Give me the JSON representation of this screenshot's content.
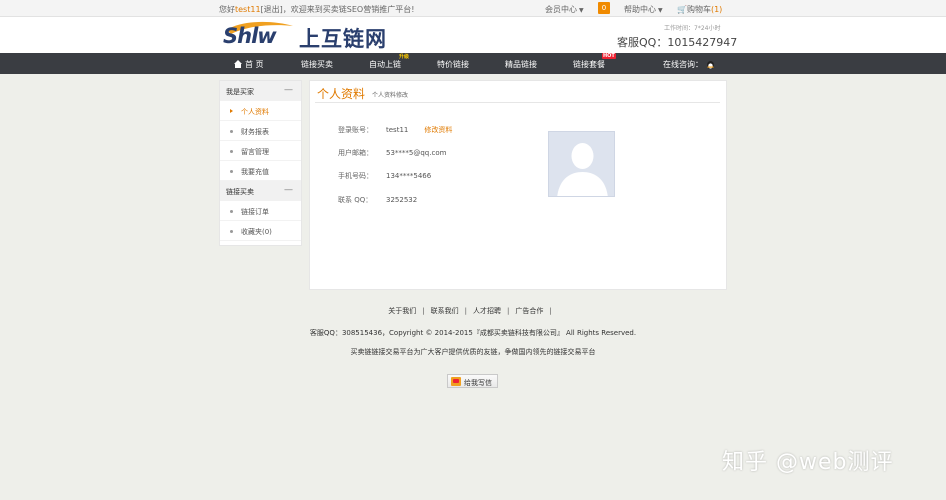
{
  "topbar": {
    "greet_prefix": "您好",
    "username": "test11",
    "greet_suffix": "[退出]，欢迎来到买卖链SEO营销推广平台!",
    "member_center": "会员中心",
    "member_badge": "0",
    "help_center": "帮助中心",
    "cart_label": "购物车",
    "cart_count": "(1)"
  },
  "header": {
    "logo_en": "Shlw",
    "logo_cn": "上互链网",
    "work_time": "工作时间：7*24小时",
    "service_qq": "客服QQ：1015427947"
  },
  "nav": {
    "items": [
      {
        "label": "首 页"
      },
      {
        "label": "链接买卖"
      },
      {
        "label": "自动上链",
        "tag": "升级"
      },
      {
        "label": "特价链接"
      },
      {
        "label": "精品链接"
      },
      {
        "label": "链接套餐",
        "tag": "HOT"
      }
    ],
    "consult": "在线咨询："
  },
  "sidebar": {
    "group1": "我是买家",
    "group1_items": [
      "个人资料",
      "财务报表",
      "留言管理",
      "我要充值"
    ],
    "group2": "链接买卖",
    "group2_items": [
      "链接订单",
      "收藏夹(0)"
    ],
    "collapse_symbol": "—"
  },
  "main": {
    "title": "个人资料",
    "subtitle": "个人资料修改",
    "fields": [
      {
        "label": "登录账号：",
        "value": "test11",
        "action": "修改资料"
      },
      {
        "label": "用户邮箱：",
        "value": "53****5@qq.com"
      },
      {
        "label": "手机号码：",
        "value": "134****5466"
      },
      {
        "label": "联系 QQ：",
        "value": "3252532"
      }
    ]
  },
  "footer": {
    "links": [
      "关于我们",
      "联系我们",
      "人才招聘",
      "广告合作"
    ],
    "separator": "|",
    "copyright": "客服QQ：308515436，Copyright © 2014-2015『成都买卖链科技有限公司』 All Rights Reserved.",
    "slogan": "买卖链链接交易平台为广大客户提供优质的友链，争做国内领先的链接交易平台",
    "message_button": "给我写信"
  },
  "watermark": "知乎 @web测评",
  "colors": {
    "accent": "#e07a00",
    "nav_bg": "#3a3d42",
    "page_bg": "#eeefea",
    "logo_blue": "#2a3f6e"
  }
}
